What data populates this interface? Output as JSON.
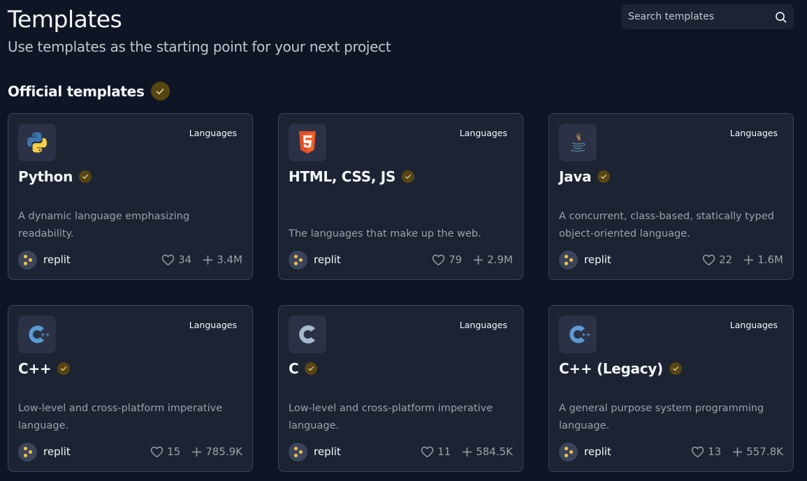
{
  "header": {
    "title": "Templates",
    "subtitle": "Use templates as the starting point for your next project",
    "search": {
      "placeholder": "Search templates",
      "value": ""
    }
  },
  "section": {
    "title": "Official templates",
    "badge_icon": "verified-check-icon"
  },
  "colors": {
    "background": "#0e1525",
    "card": "#1c2333",
    "card_border": "#3c445c",
    "verified_badge": "#574512",
    "muted_text": "#9da2a6"
  },
  "templates": [
    {
      "name": "Python",
      "category": "Languages",
      "logo": "python-logo-icon",
      "description": "A dynamic language emphasizing readability.",
      "author": "replit",
      "likes": "34",
      "forks": "3.4M"
    },
    {
      "name": "HTML, CSS, JS",
      "category": "Languages",
      "logo": "html5-logo-icon",
      "description": "The languages that make up the web.",
      "author": "replit",
      "likes": "79",
      "forks": "2.9M"
    },
    {
      "name": "Java",
      "category": "Languages",
      "logo": "java-logo-icon",
      "description": "A concurrent, class-based, statically typed object-oriented language.",
      "author": "replit",
      "likes": "22",
      "forks": "1.6M"
    },
    {
      "name": "C++",
      "category": "Languages",
      "logo": "cpp-logo-icon",
      "description": "Low-level and cross-platform imperative language.",
      "author": "replit",
      "likes": "15",
      "forks": "785.9K"
    },
    {
      "name": "C",
      "category": "Languages",
      "logo": "c-logo-icon",
      "description": "Low-level and cross-platform imperative language.",
      "author": "replit",
      "likes": "11",
      "forks": "584.5K"
    },
    {
      "name": "C++ (Legacy)",
      "category": "Languages",
      "logo": "cpp-logo-icon",
      "description": "A general purpose system programming language.",
      "author": "replit",
      "likes": "13",
      "forks": "557.8K"
    }
  ]
}
